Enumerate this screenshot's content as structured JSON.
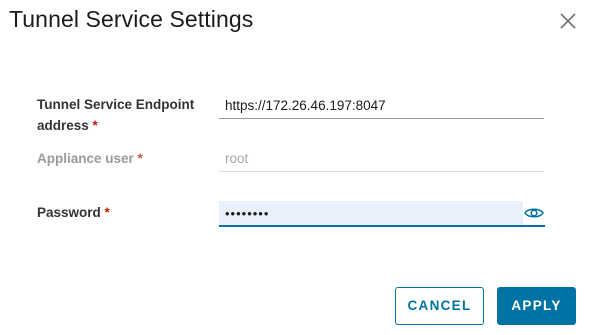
{
  "dialog": {
    "title": "Tunnel Service Settings"
  },
  "icons": {
    "close": "close-icon",
    "eye": "eye-icon"
  },
  "form": {
    "endpoint": {
      "label": "Tunnel Service Endpoint address",
      "required_mark": "*",
      "value": "https://172.26.46.197:8047"
    },
    "appliance_user": {
      "label": "Appliance user",
      "required_mark": "*",
      "value": "root",
      "disabled": true
    },
    "password": {
      "label": "Password",
      "required_mark": "*",
      "masked_value": "••••••••"
    }
  },
  "buttons": {
    "cancel": "CANCEL",
    "apply": "APPLY"
  },
  "colors": {
    "primary": "#0072a3",
    "required": "#c21d00",
    "active_field_bg": "#e9effb"
  }
}
